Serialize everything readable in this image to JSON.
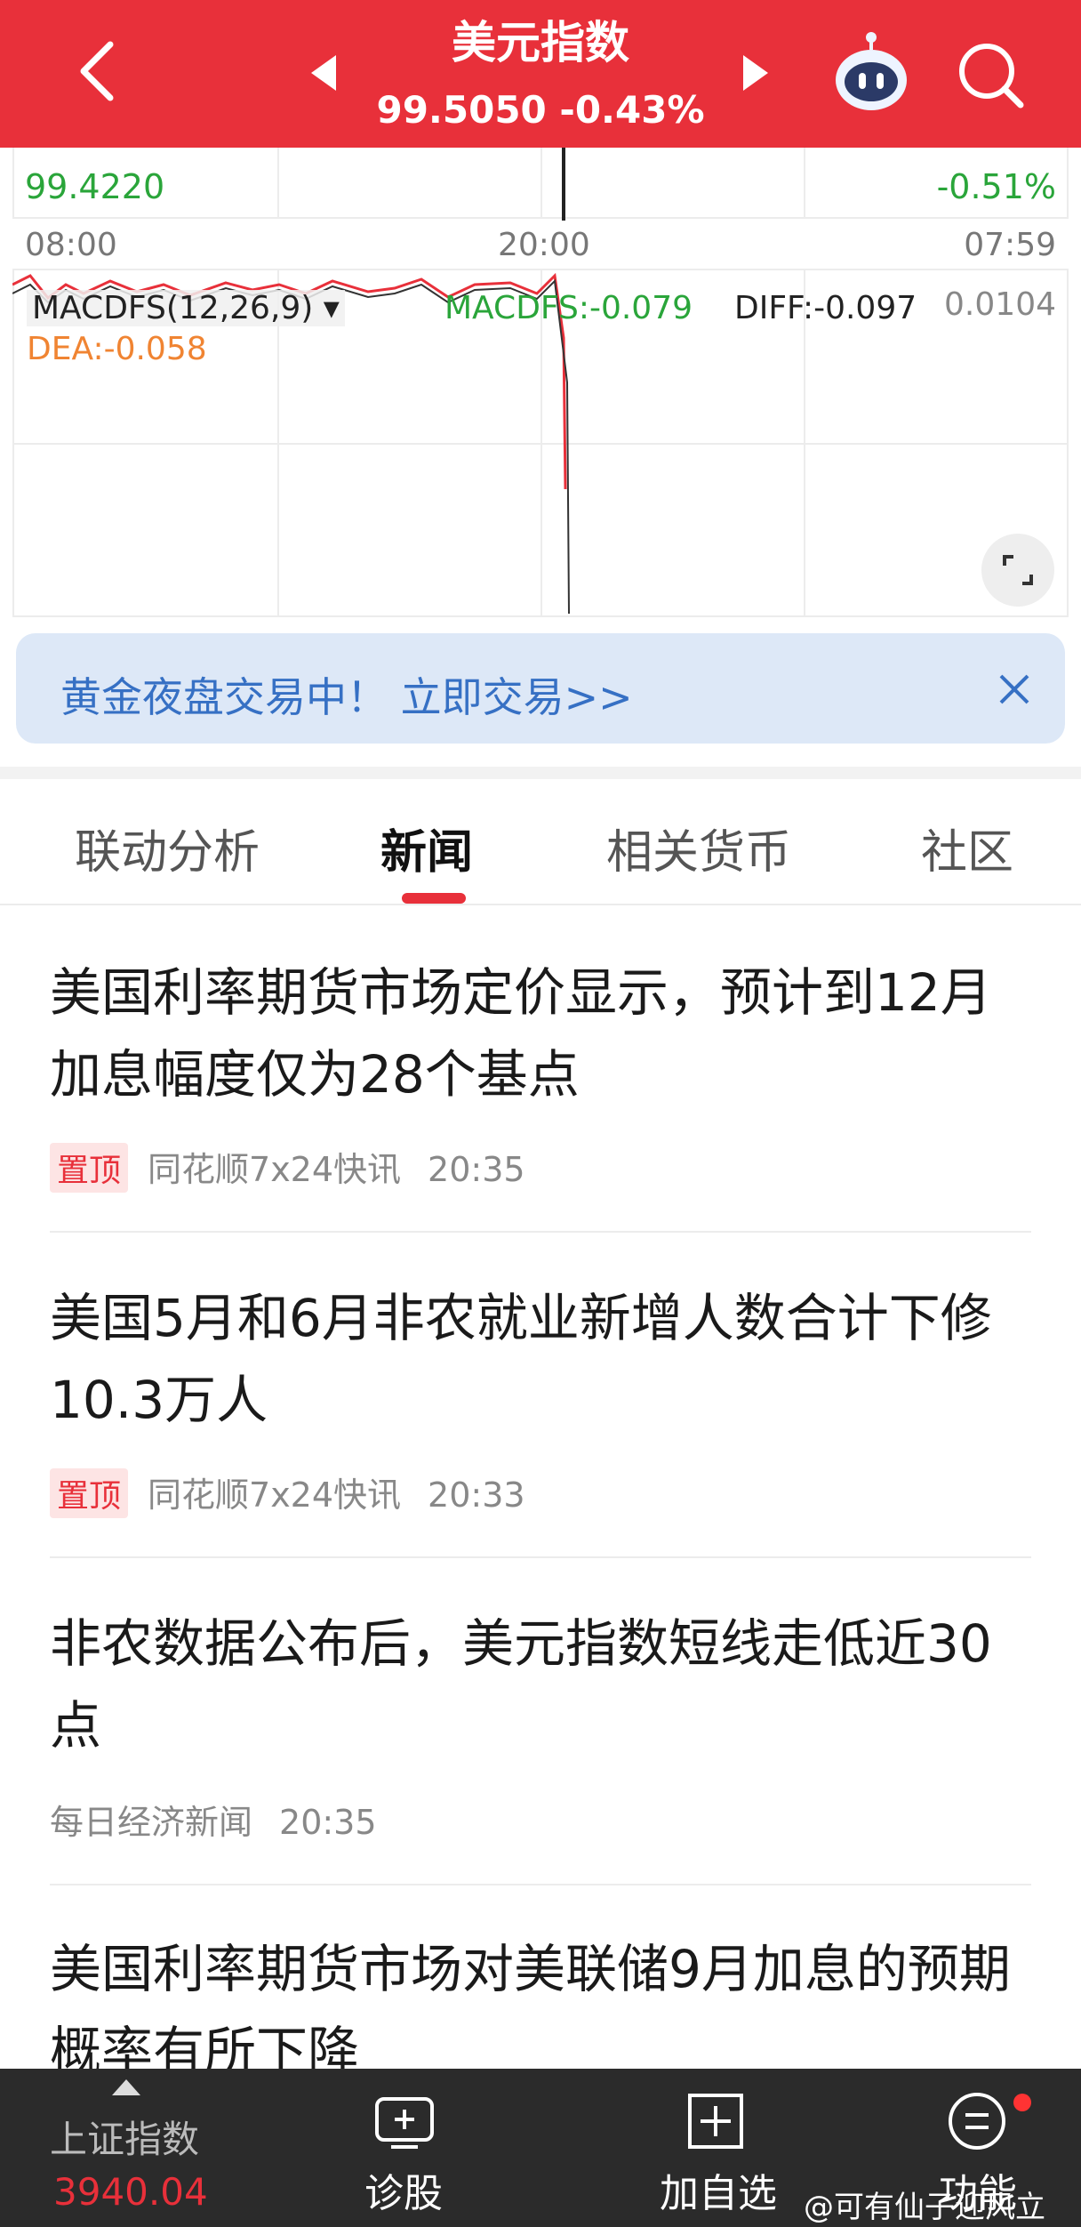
{
  "header": {
    "title": "美元指数",
    "price": "99.5050",
    "change": "-0.43%"
  },
  "chart": {
    "low_price": "99.4220",
    "low_pct": "-0.51%",
    "time_start": "08:00",
    "time_mid": "20:00",
    "time_end": "07:59",
    "macd_label": "MACDFS(12,26,9)",
    "macd_value": "MACDFS:-0.079",
    "diff_value": "DIFF:-0.097",
    "axis_value": "0.0104",
    "dea_value": "DEA:-0.058",
    "colors": {
      "up": "#e8303a",
      "down": "#2aa53a",
      "dea": "#f08432"
    }
  },
  "banner": {
    "text": "黄金夜盘交易中！ 立即交易>>"
  },
  "tabs": [
    {
      "label": "联动分析"
    },
    {
      "label": "新闻"
    },
    {
      "label": "相关货币"
    },
    {
      "label": "社区"
    }
  ],
  "news": [
    {
      "title": "美国利率期货市场定价显示，预计到12月加息幅度仅为28个基点",
      "pin": "置顶",
      "source": "同花顺7x24快讯",
      "time": "20:35"
    },
    {
      "title": "美国5月和6月非农就业新增人数合计下修10.3万人",
      "pin": "置顶",
      "source": "同花顺7x24快讯",
      "time": "20:33"
    },
    {
      "title": "非农数据公布后，美元指数短线走低近30点",
      "pin": "",
      "source": "每日经济新闻",
      "time": "20:35"
    },
    {
      "title": "美国利率期货市场对美联储9月加息的预期概率有所下降",
      "pin": "",
      "source": "",
      "time": ""
    }
  ],
  "bottom_bar": {
    "index_name": "上证指数",
    "index_value": "3940.04",
    "diagnose": "诊股",
    "add_watch": "加自选",
    "function": "功能"
  },
  "watermark": "@可有仙子迎风立"
}
